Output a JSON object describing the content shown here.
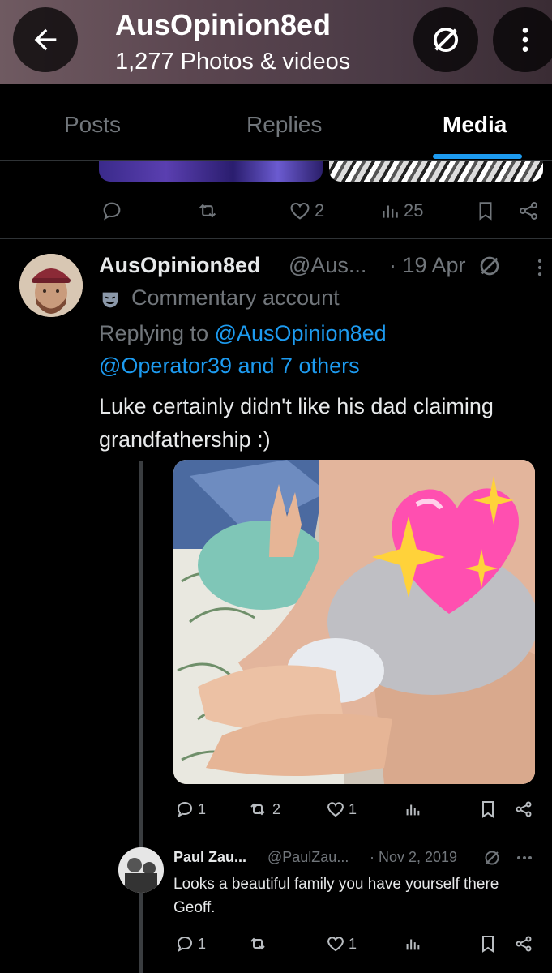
{
  "header": {
    "title": "AusOpinion8ed",
    "subtitle": "1,277 Photos & videos"
  },
  "tabs": [
    {
      "label": "Posts"
    },
    {
      "label": "Replies"
    },
    {
      "label": "Media"
    }
  ],
  "active_tab": "Media",
  "prev_tweet": {
    "likes": "2",
    "views": "25"
  },
  "tweet": {
    "name": "AusOpinion8ed",
    "handle": "@Aus...",
    "date": "· 19 Apr",
    "label": "Commentary account",
    "replying_prefix": "Replying to ",
    "replying_to1": "@AusOpinion8ed",
    "replying_to2": "@Operator39 and 7 others",
    "text": "Luke certainly didn't like his dad claiming grandfathership :)",
    "replies": "1",
    "retweets": "2",
    "likes": "1"
  },
  "reply": {
    "name": "Paul Zau...",
    "handle": "@PaulZau...",
    "date": "· Nov 2, 2019",
    "text": "Looks a beautiful family you have yourself there Geoff.",
    "replies": "1",
    "likes": "1"
  },
  "colors": {
    "accent": "#1d9bf0",
    "muted": "#71767b",
    "text": "#e7e9ea",
    "background": "#000000"
  }
}
